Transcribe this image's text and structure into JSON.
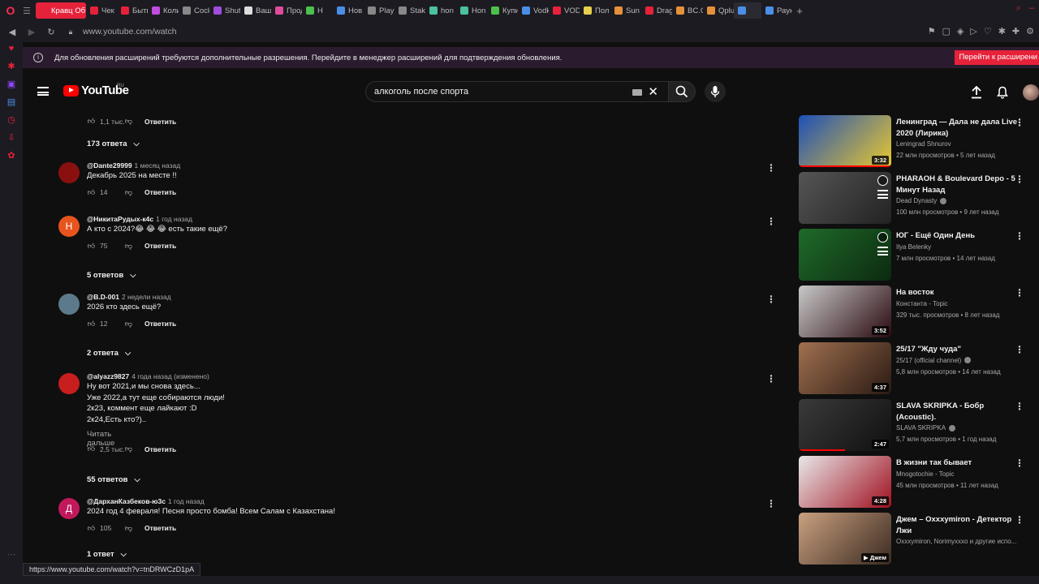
{
  "browser": {
    "tabs": [
      {
        "label": "Кравц Об",
        "color": "#e6223a",
        "active": true
      },
      {
        "label": "Чек",
        "color": "#e6223a"
      },
      {
        "label": "Быть",
        "color": "#e6223a"
      },
      {
        "label": "Коли",
        "color": "#c04ce0"
      },
      {
        "label": "Cock",
        "color": "#888888"
      },
      {
        "label": "Shut",
        "color": "#a04ce0"
      },
      {
        "label": "Ваш",
        "color": "#dddddd"
      },
      {
        "label": "Прод",
        "color": "#e04c9c"
      },
      {
        "label": "Н",
        "color": "#4cc04c"
      },
      {
        "label": "Нов",
        "color": "#4a8ee6"
      },
      {
        "label": "Play",
        "color": "#888888"
      },
      {
        "label": "Stak",
        "color": "#888888"
      },
      {
        "label": "hon",
        "color": "#4cc0a0"
      },
      {
        "label": "Hon",
        "color": "#4cc0a0"
      },
      {
        "label": "Купи",
        "color": "#4cc04c"
      },
      {
        "label": "Vodk",
        "color": "#4a8ee6"
      },
      {
        "label": "VOD",
        "color": "#e6223a"
      },
      {
        "label": "Пол",
        "color": "#e6d04c"
      },
      {
        "label": "Sun",
        "color": "#e6903a"
      },
      {
        "label": "Drag",
        "color": "#e6223a"
      },
      {
        "label": "BC.G",
        "color": "#e6903a"
      },
      {
        "label": "Qplu",
        "color": "#e6903a"
      },
      {
        "label": "",
        "color": "#4a8ee6",
        "active2": true
      },
      {
        "label": "Раун",
        "color": "#4a8ee6"
      }
    ],
    "new_tab": "+",
    "url": "www.youtube.com/watch",
    "status_url": "https://www.youtube.com/watch?v=tnDRWCzD1pA"
  },
  "notice": {
    "text": "Для обновления расширений требуются дополнительные разрешения. Перейдите в менеджер расширений для подтверждения обновления.",
    "button": "Перейти к расширени"
  },
  "youtube": {
    "logo_text": "YouTube",
    "country": "RU",
    "search_value": "алкоголь после спорта"
  },
  "comments": [
    {
      "type": "actions",
      "likes": "1,1 тыс.",
      "reply": "Ответить"
    },
    {
      "type": "replies",
      "label": "173 ответа"
    },
    {
      "type": "comment",
      "author": "@Dante29999",
      "time": "1 месяц назад",
      "avatar_color": "#8a1010",
      "avatar_letter": "",
      "lines": [
        "Декабрь 2025 на месте !!"
      ],
      "likes": "14",
      "reply": "Ответить"
    },
    {
      "type": "comment",
      "author": "@НикитаРудых-к4с",
      "time": "1 год назад",
      "avatar_color": "#e8541e",
      "avatar_letter": "Н",
      "lines": [
        "А кто с 2024?😂 😂 😂 есть такие ещё?"
      ],
      "likes": "75",
      "reply": "Ответить"
    },
    {
      "type": "replies",
      "label": "5 ответов"
    },
    {
      "type": "comment",
      "author": "@B.D-001",
      "time": "2 недели назад",
      "avatar_color": "#5d7a8c",
      "avatar_letter": "",
      "lines": [
        "2026 кто здесь ещё?"
      ],
      "likes": "12",
      "reply": "Ответить"
    },
    {
      "type": "replies",
      "label": "2 ответа"
    },
    {
      "type": "comment",
      "author": "@alyazz9827",
      "time": "4 года назад (изменено)",
      "avatar_color": "#c81e1e",
      "avatar_letter": "",
      "lines": [
        "Ну вот 2021,и мы снова здесь...",
        "Уже 2022,а тут еще собираются люди!",
        "2к23, коммент еще лайкают :D",
        "2к24,Есть кто?).."
      ],
      "more": "Читать дальше",
      "likes": "2,5 тыс.",
      "reply": "Ответить"
    },
    {
      "type": "replies",
      "label": "55 ответов"
    },
    {
      "type": "comment",
      "author": "@ДарханКазбеков-ю3с",
      "time": "1 год назад",
      "avatar_color": "#c2185b",
      "avatar_letter": "Д",
      "lines": [
        "2024 год 4 февраля! Песня просто бомба! Всем Салам с Казахстана!"
      ],
      "likes": "105",
      "reply": "Ответить"
    },
    {
      "type": "replies",
      "label": "1 ответ"
    }
  ],
  "recommendations": [
    {
      "title": "Ленинград — Дала не дала Live 2020 (Лирика)",
      "channel": "Leningrad Shnurov",
      "meta": "22 млн просмотров • 5 лет назад",
      "duration": "3:32",
      "thumb": [
        "#1e4fb8",
        "#e8c830"
      ],
      "progress": 1.0
    },
    {
      "title": "PHARAOH & Boulevard Depo - 5 Минут Назад",
      "channel": "Dead Dynasty",
      "meta": "100 млн просмотров • 9 лет назад",
      "duration": "",
      "thumb": [
        "#555555",
        "#222222"
      ],
      "verified": true,
      "hover": true
    },
    {
      "title": "ЮГ - Ещё Один День",
      "channel": "Ilya Belenky",
      "meta": "7 млн просмотров • 14 лет назад",
      "duration": "",
      "thumb": [
        "#1f6a2a",
        "#0c2a10"
      ],
      "hover": true
    },
    {
      "title": "На восток",
      "channel": "Константа - Topic",
      "meta": "329 тыс. просмотров • 8 лет назад",
      "duration": "3:52",
      "thumb": [
        "#c8c8c8",
        "#2a0a10"
      ]
    },
    {
      "title": "25/17 \"Жду чуда\"",
      "channel": "25/17 (official channel)",
      "meta": "5,8 млн просмотров • 14 лет назад",
      "duration": "4:37",
      "thumb": [
        "#a07050",
        "#2a1a12"
      ],
      "verified": true
    },
    {
      "title": "SLAVA SKRIPKA - Бобр (Acoustic).",
      "channel": "SLAVA SKRIPKA",
      "meta": "5,7 млн просмотров • 1 год назад",
      "duration": "2:47",
      "thumb": [
        "#3a3a3a",
        "#101010"
      ],
      "verified": true,
      "progress": 0.5
    },
    {
      "title": "В жизни так бывает",
      "channel": "Mnogotochie - Topic",
      "meta": "45 млн просмотров • 11 лет назад",
      "duration": "4:28",
      "thumb": [
        "#e8e8e8",
        "#a01020"
      ]
    },
    {
      "title": "Джем – Oxxxymiron - Детектор Лжи",
      "channel": "Oxxxymiron, Norimyxxxo и другие испо...",
      "meta": "",
      "duration": "▶ Джем",
      "thumb": [
        "#caa080",
        "#3a2a20"
      ]
    }
  ]
}
